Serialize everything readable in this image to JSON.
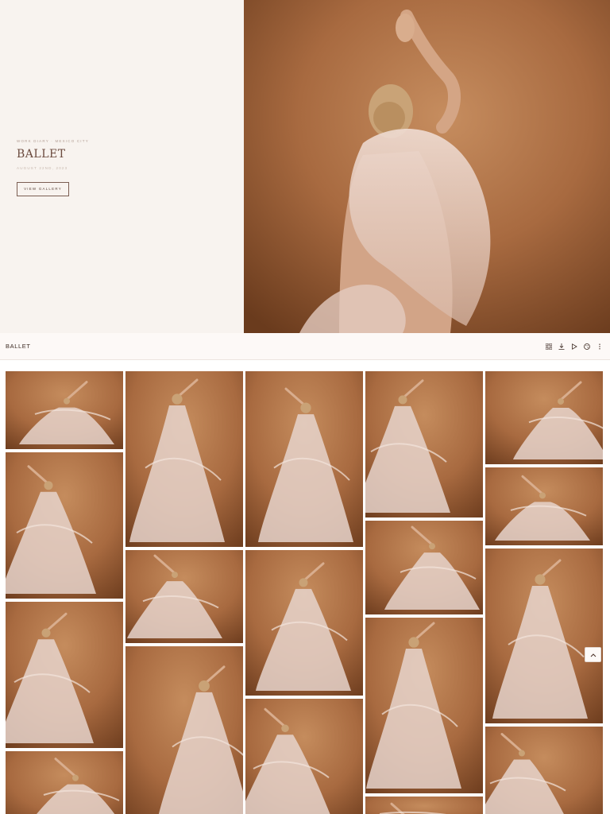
{
  "hero": {
    "eyebrow": "WORK DIARY · MEXICO CITY",
    "title": "BALLET",
    "date": "AUGUST 22ND, 2023",
    "button_label": "VIEW GALLERY"
  },
  "toolbar": {
    "title": "BALLET",
    "icons": [
      "grid-icon",
      "download-icon",
      "play-icon",
      "palette-icon",
      "more-icon"
    ]
  },
  "gallery": {
    "photo_count_visible": 20,
    "backdrop_color": "#a8693f",
    "dress_color": "#e6d3cb"
  },
  "colors": {
    "hero_bg": "#f8f3ef",
    "title_color": "#6b4a3e",
    "photo_bg": "#a4683f"
  }
}
